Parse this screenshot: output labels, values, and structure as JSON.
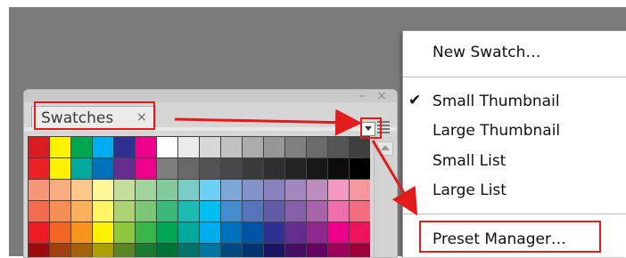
{
  "panel": {
    "tab_label": "Swatches",
    "tab_close_glyph": "×",
    "minimize_glyph": "–",
    "close_glyph": "×"
  },
  "swatches": [
    "#d91c22",
    "#fff200",
    "#00a650",
    "#00aeef",
    "#2e3192",
    "#ec008c",
    "#ffffff",
    "#ebebeb",
    "#d7d7d7",
    "#c2c2c2",
    "#acacac",
    "#969696",
    "#808080",
    "#6b6b6b",
    "#555555",
    "#3f3f3f",
    "#ea2026",
    "#fff200",
    "#00a99d",
    "#0072bc",
    "#662d91",
    "#ec008c",
    "#7d7d7d",
    "#686868",
    "#535353",
    "#474747",
    "#3b3b3b",
    "#2f2f2f",
    "#242424",
    "#181818",
    "#0c0c0c",
    "#000000",
    "#f69679",
    "#f9ad81",
    "#fdc68a",
    "#fff79a",
    "#c4df9b",
    "#a3d39c",
    "#82ca9c",
    "#7accc8",
    "#6dcff6",
    "#7da7d9",
    "#8393ca",
    "#8781bd",
    "#a187be",
    "#bd8cbf",
    "#f49ac2",
    "#f5989d",
    "#f26c4f",
    "#f68e56",
    "#fbaf5d",
    "#fff568",
    "#acd373",
    "#7cc576",
    "#3cb878",
    "#1cbbb4",
    "#00bff3",
    "#448ccb",
    "#5574b9",
    "#605ca8",
    "#8560a8",
    "#a864a8",
    "#f06eaa",
    "#f26d7d",
    "#ed1c24",
    "#f26522",
    "#f7941d",
    "#fff200",
    "#8dc63f",
    "#39b54a",
    "#00a651",
    "#00a99d",
    "#00aeef",
    "#0072bc",
    "#0054a6",
    "#2e3192",
    "#662d91",
    "#92278f",
    "#ec008c",
    "#ed145b",
    "#9e0b0f",
    "#a0410d",
    "#a3620a",
    "#aba000",
    "#598527",
    "#197b30",
    "#007236",
    "#00746b",
    "#0076a3",
    "#004a80",
    "#003471",
    "#1b1464",
    "#440e62",
    "#630460",
    "#9e005d",
    "#9e0039"
  ],
  "menu": {
    "items": [
      {
        "label": "New Swatch…",
        "checked": false
      },
      {
        "label": "Small Thumbnail",
        "checked": true
      },
      {
        "label": "Large Thumbnail",
        "checked": false
      },
      {
        "label": "Small List",
        "checked": false
      },
      {
        "label": "Large List",
        "checked": false
      },
      {
        "label": "Preset Manager…",
        "checked": false
      }
    ],
    "check_glyph": "✔"
  },
  "colors": {
    "annotation_red": "#e21b1b",
    "workspace_gray": "#7a7a7a"
  }
}
